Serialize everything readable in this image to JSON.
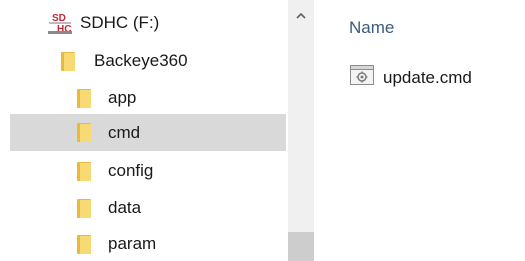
{
  "navigation": {
    "drive": {
      "label": "SDHC (F:)",
      "icon": "sd-card-icon"
    },
    "items": [
      {
        "label": "Backeye360",
        "icon": "folder-icon",
        "selected": false
      },
      {
        "label": "app",
        "icon": "folder-icon",
        "selected": false
      },
      {
        "label": "cmd",
        "icon": "folder-icon",
        "selected": true
      },
      {
        "label": "config",
        "icon": "folder-icon",
        "selected": false
      },
      {
        "label": "data",
        "icon": "folder-icon",
        "selected": false
      },
      {
        "label": "param",
        "icon": "folder-icon",
        "selected": false
      }
    ]
  },
  "scrollbar": {
    "up_icon": "chevron-up-icon"
  },
  "content": {
    "columns": [
      {
        "label": "Name"
      }
    ],
    "files": [
      {
        "name": "update.cmd",
        "icon": "windows-command-script-icon"
      }
    ]
  },
  "colors": {
    "selection": "#d9d9d9",
    "header_text": "#3c5a7a",
    "folder": "#f5d56b",
    "scrollbar_track": "#f0f0f0",
    "scrollbar_thumb": "#cdcdcd"
  }
}
